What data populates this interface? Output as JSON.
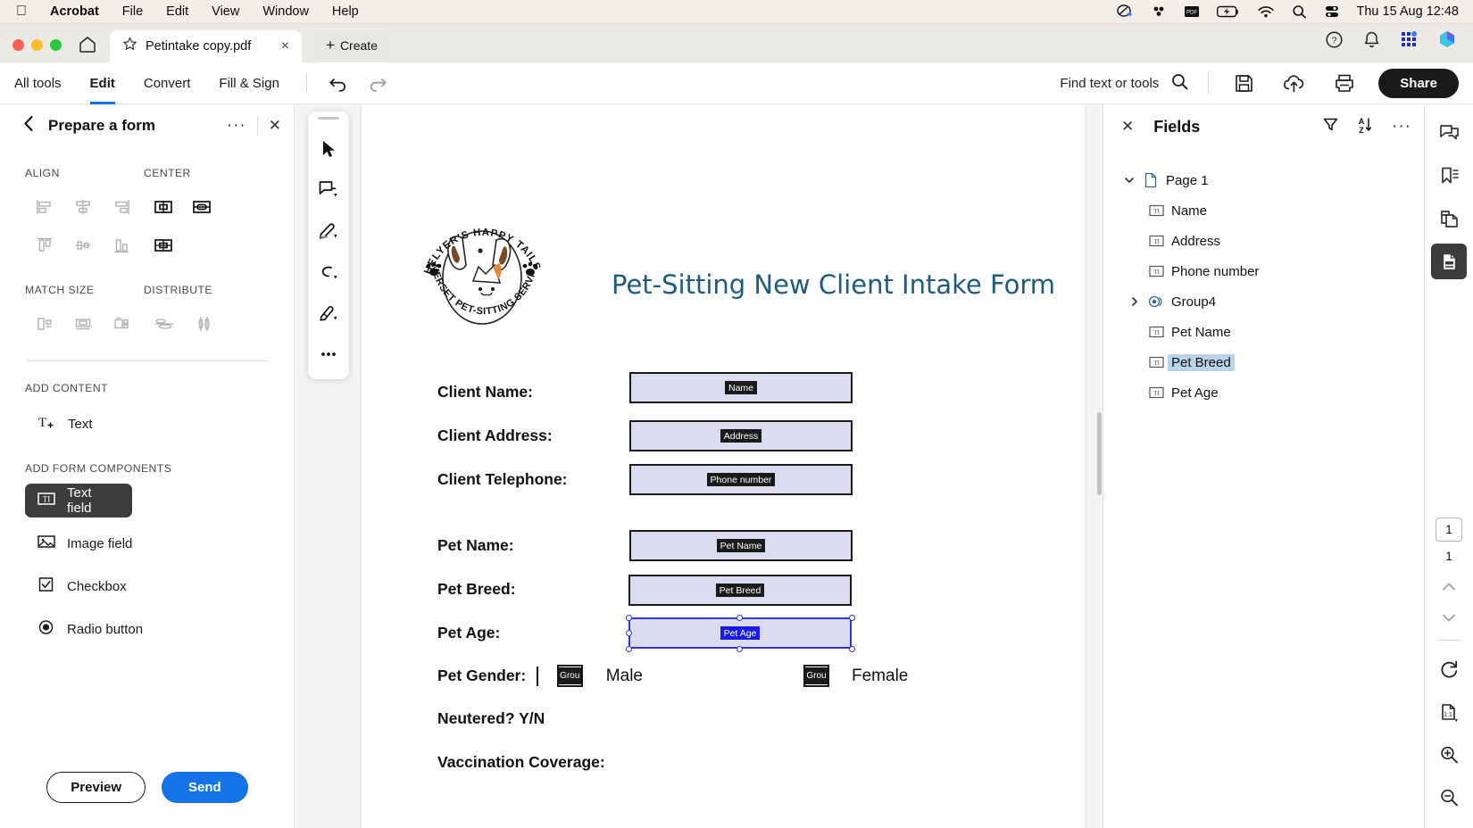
{
  "menubar": {
    "apple": "apple-logo",
    "app": "Acrobat",
    "items": [
      "File",
      "Edit",
      "View",
      "Window",
      "Help"
    ],
    "status_icons": [
      "screen-share-icon",
      "dots-cluster-icon",
      "pdf-icon",
      "battery-charging-icon",
      "wifi-icon",
      "search-icon",
      "control-center-icon"
    ],
    "clock": "Thu 15 Aug  12:48"
  },
  "tabbar": {
    "home": "home-icon",
    "tab_title": "Petintake copy.pdf",
    "tab_close": "×",
    "create_label": "Create",
    "create_plus": "+",
    "right_icons": [
      "help-icon",
      "bell-icon",
      "apps-grid-icon",
      "account-icon"
    ]
  },
  "toolbar": {
    "tabs": [
      {
        "label": "All tools",
        "active": false
      },
      {
        "label": "Edit",
        "active": true
      },
      {
        "label": "Convert",
        "active": false
      },
      {
        "label": "Fill & Sign",
        "active": false
      }
    ],
    "undo": "undo-icon",
    "redo": "redo-icon",
    "find_placeholder": "Find text or tools",
    "save_icon": "save-icon",
    "upload_icon": "cloud-upload-icon",
    "print_icon": "print-icon",
    "share_label": "Share"
  },
  "left_panel": {
    "back": "‹",
    "title": "Prepare a form",
    "more": "···",
    "close": "✕",
    "align_label": "ALIGN",
    "center_label": "CENTER",
    "match_size_label": "MATCH SIZE",
    "distribute_label": "DISTRIBUTE",
    "align_icons": [
      "align-left-icon",
      "align-center-horizontal-icon",
      "align-right-icon",
      "align-top-icon",
      "align-middle-vertical-icon",
      "align-bottom-icon"
    ],
    "center_icons": [
      "center-horizontally-icon",
      "center-vertically-icon",
      "center-both-icon"
    ],
    "match_size_icons": [
      "match-width-icon",
      "match-height-icon",
      "match-both-icon"
    ],
    "distribute_icons": [
      "distribute-horizontal-icon",
      "distribute-vertical-icon"
    ],
    "add_content_label": "ADD CONTENT",
    "add_content_items": [
      {
        "label": "Text",
        "icon": "text-add-icon"
      }
    ],
    "add_components_label": "ADD FORM COMPONENTS",
    "components": [
      {
        "label": "Text field",
        "icon": "text-field-icon",
        "selected": true
      },
      {
        "label": "Image field",
        "icon": "image-field-icon",
        "selected": false
      },
      {
        "label": "Checkbox",
        "icon": "checkbox-icon",
        "selected": false
      },
      {
        "label": "Radio button",
        "icon": "radio-button-icon",
        "selected": false
      }
    ],
    "preview_label": "Preview",
    "send_label": "Send"
  },
  "tool_rail": {
    "tools": [
      "select-cursor-icon",
      "comment-box-icon",
      "highlighter-pen-icon",
      "lasso-draw-icon",
      "fill-signature-icon",
      "more-tools-icon"
    ]
  },
  "document": {
    "logo": {
      "top_arc": "HELYER'S HAPPY TAILS",
      "bottom_arc": "SOMERSET PET-SITTING SERVICES"
    },
    "title": "Pet-Sitting New Client Intake Form",
    "rows": [
      {
        "label": "Client Name:",
        "tag": "Name",
        "selected": false
      },
      {
        "label": "Client Address:",
        "tag": "Address",
        "selected": false
      },
      {
        "label": "Client Telephone:",
        "tag": "Phone number",
        "selected": false
      },
      {
        "label": "Pet Name:",
        "tag": "Pet Name",
        "selected": false
      },
      {
        "label": "Pet Breed:",
        "tag": "Pet Breed",
        "selected": false
      },
      {
        "label": "Pet Age:",
        "tag": "Pet Age",
        "selected": true
      }
    ],
    "gender": {
      "label": "Pet Gender:",
      "option_a_tag": "Grou",
      "option_a": "Male",
      "option_b_tag": "Grou",
      "option_b": "Female"
    },
    "neutered_label": "Neutered? Y/N",
    "vaccination_label": "Vaccination Coverage:"
  },
  "fields_panel": {
    "close": "✕",
    "title": "Fields",
    "filter_icon": "filter-funnel-icon",
    "sort_icon": "sort-az-icon",
    "more_icon": "···",
    "tree": [
      {
        "label": "Page 1",
        "icon": "page-icon",
        "level": 1,
        "twist": "expanded",
        "selected": false
      },
      {
        "label": "Name",
        "icon": "text-field-icon",
        "level": 2,
        "twist": "none",
        "selected": false
      },
      {
        "label": "Address",
        "icon": "text-field-icon",
        "level": 2,
        "twist": "none",
        "selected": false
      },
      {
        "label": "Phone number",
        "icon": "text-field-icon",
        "level": 2,
        "twist": "none",
        "selected": false
      },
      {
        "label": "Group4",
        "icon": "radio-group-icon",
        "level": 2,
        "twist": "collapsed",
        "selected": false
      },
      {
        "label": "Pet Name",
        "icon": "text-field-icon",
        "level": 2,
        "twist": "none",
        "selected": false
      },
      {
        "label": "Pet Breed",
        "icon": "text-field-icon",
        "level": 2,
        "twist": "none",
        "selected": true
      },
      {
        "label": "Pet Age",
        "icon": "text-field-icon",
        "level": 2,
        "twist": "none",
        "selected": false
      }
    ]
  },
  "far_rail": {
    "top_icons": [
      {
        "icon": "comment-bubble-icon",
        "active": false
      },
      {
        "icon": "bookmark-icon",
        "active": false
      },
      {
        "icon": "page-thumbnails-icon",
        "active": false
      },
      {
        "icon": "form-fields-panel-icon",
        "active": true
      }
    ],
    "current_page": "1",
    "total_pages": "1",
    "prev_icon": "chevron-up-icon",
    "next_icon": "chevron-down-icon",
    "rotate_icon": "rotate-clockwise-icon",
    "fit_icon": "fit-page-icon",
    "zoom_in_icon": "zoom-in-icon",
    "zoom_out_icon": "zoom-out-icon"
  },
  "colors": {
    "accent_blue": "#1473e6",
    "field_fill": "#dcdcf0",
    "selection_blue": "#3333dd",
    "tree_selection": "#b8d4ea",
    "doc_title": "#1f5c7a"
  }
}
